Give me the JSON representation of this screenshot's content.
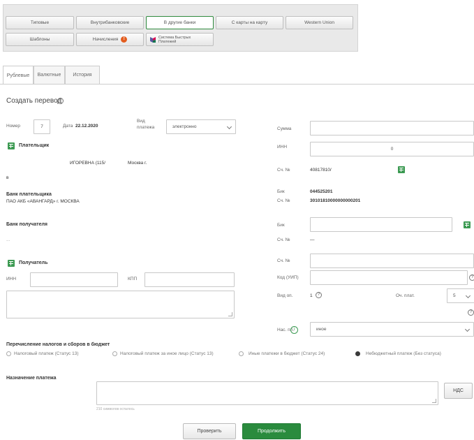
{
  "toolbar": {
    "tabs": [
      "Типовые",
      "Внутрибанковские",
      "В другие банки",
      "С карты на карту",
      "Western Union"
    ],
    "row2": [
      "Шаблоны",
      "Начисления",
      "Система Быстрых Платежей"
    ],
    "accruals_badge": "!"
  },
  "currency_tabs": [
    "Рублевые",
    "Валютные",
    "История"
  ],
  "form": {
    "title": "Создать перевод",
    "help_icon": "?",
    "number_label": "Номер",
    "number_value": "7",
    "date_label": "Дата",
    "date_value": "22.12.2020",
    "pay_type_label_1": "Вид",
    "pay_type_label_2": "платежа",
    "pay_type_value": "электронно",
    "payer_label": "Плательщик",
    "payer_name": "ИГОРЕВНА (115/",
    "payer_city": "Москва г.",
    "payer_extra": "в",
    "payer_bank_label": "Банк плательщика",
    "payer_bank_name": "ПАО АКБ «АВАНГАРД» г. МОСКВА",
    "recipient_bank_label": "Банк получателя",
    "recipient_bank_value": "...",
    "recipient_label": "Получатель",
    "inn_label": "ИНН",
    "kpp_label": "КПП",
    "sum_label": "Сумма",
    "inn_right_label": "ИНН",
    "inn_right_value": "0",
    "acct_label": "Сч. №",
    "acct_value": "40817810/",
    "bik_label": "Бик",
    "bik_value": "044525201",
    "corr_label": "Сч. №",
    "corr_value": "30101810000000000201",
    "rbik_label": "Бик",
    "racct_label": "Сч. №",
    "racct_value": "—",
    "racct2_label": "Сч. №",
    "uin_label": "Код (УИП)",
    "op_type_label": "Вид оп.",
    "op_type_value": "1",
    "priority_label": "Оч. плат.",
    "priority_value": "5",
    "payment_id_label": "Нас. пл.",
    "payment_id_value": "иное",
    "tax_section_title": "Перечисление налогов и сборов в бюджет",
    "radio_options": [
      "Налоговый платеж (Статус 13)",
      "Налоговый платеж за иное лицо (Статус 13)",
      "Иные платежи в бюджет (Статус 24)",
      "Небюджетный платеж (Без статуса)"
    ],
    "purpose_label": "Назначение платежа",
    "purpose_hint": "210 символов осталось",
    "vat_button": "НДС"
  },
  "actions": {
    "check": "Проверить",
    "continue": "Продолжить"
  },
  "colors": {
    "accent_green": "#2a8b3e",
    "badge_orange": "#e35d1f"
  }
}
